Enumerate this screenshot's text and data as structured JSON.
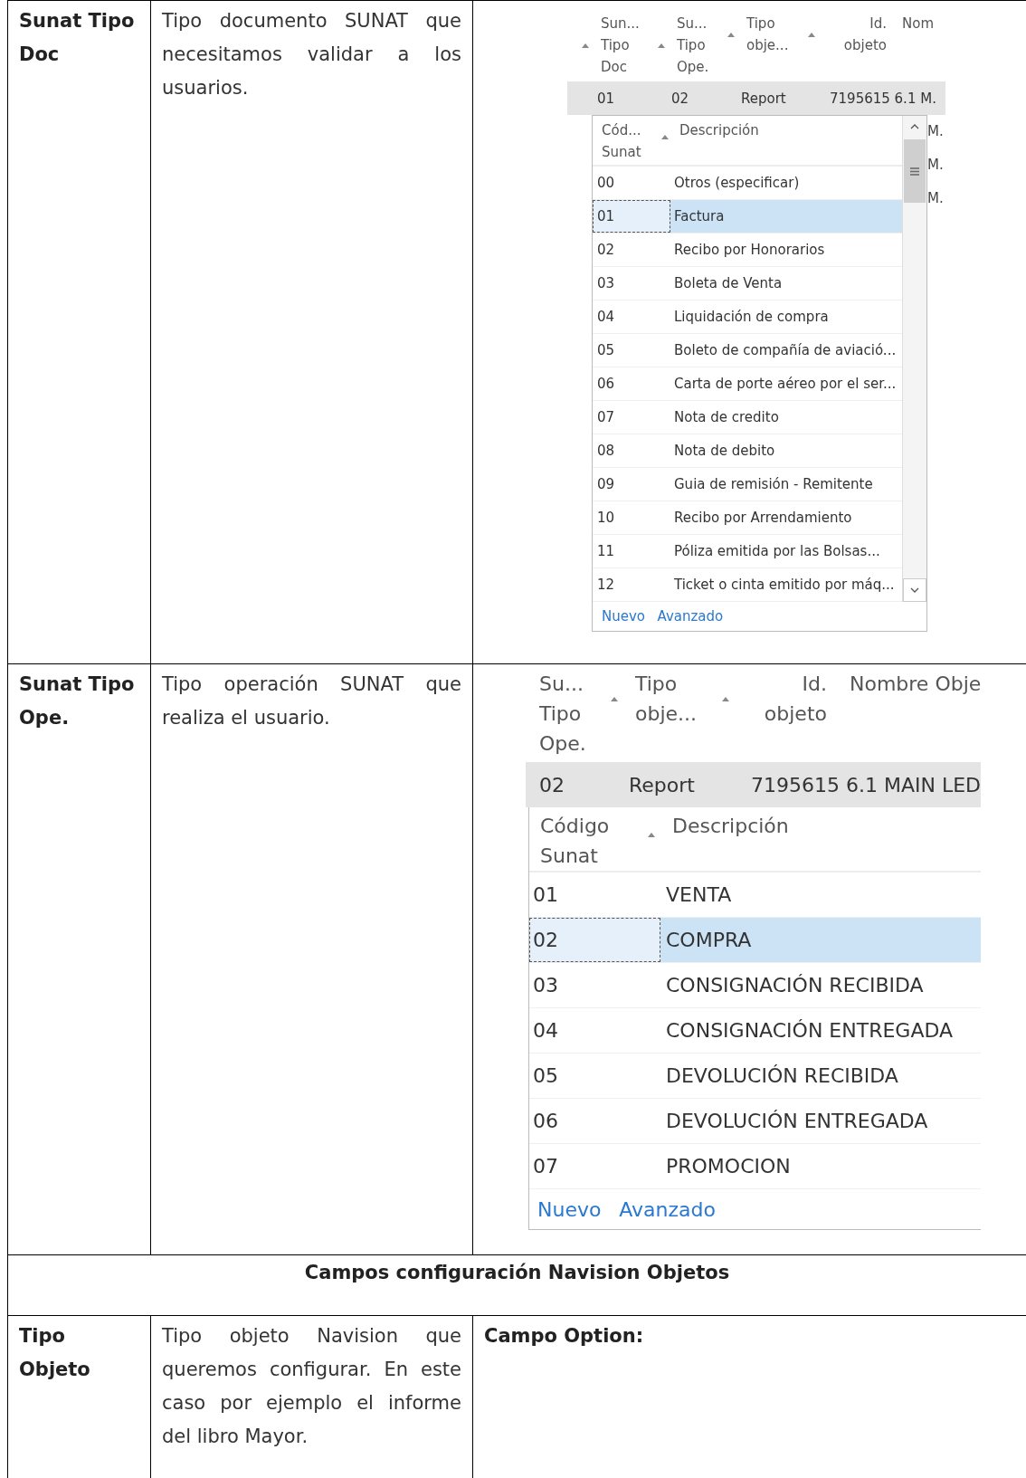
{
  "table": {
    "rows": [
      {
        "kind": "field",
        "label": "Sunat Tipo Doc",
        "description": "Tipo documento SUNAT que necesitamos validar a los usuarios.",
        "screenshot": {
          "grid_columns": [
            {
              "title": "Sun...\nTipo\nDoc",
              "sort_mark": true
            },
            {
              "title": "Su...\nTipo\nOpe.",
              "sort_mark": true
            },
            {
              "title": "Tipo\nobje...",
              "sort_mark": true
            },
            {
              "title": "Id.\nobjeto",
              "sort_mark": true
            },
            {
              "title": "Nom",
              "sort_mark": false
            }
          ],
          "grid_row": [
            "01",
            "02",
            "Report",
            "7195615 6.1 M."
          ],
          "side_values": [
            "M.",
            "M.",
            "M."
          ],
          "dropdown": {
            "columns": [
              {
                "title": "Cód...\nSunat",
                "sort_mark": false
              },
              {
                "title": "Descripción",
                "sort_mark": true
              }
            ],
            "rows": [
              {
                "code": "00",
                "description": "Otros (especificar)",
                "selected": false
              },
              {
                "code": "01",
                "description": "Factura",
                "selected": true
              },
              {
                "code": "02",
                "description": "Recibo por Honorarios",
                "selected": false
              },
              {
                "code": "03",
                "description": "Boleta de Venta",
                "selected": false
              },
              {
                "code": "04",
                "description": "Liquidación de compra",
                "selected": false
              },
              {
                "code": "05",
                "description": "Boleto de compañía de aviació...",
                "selected": false
              },
              {
                "code": "06",
                "description": "Carta de porte aéreo por el ser...",
                "selected": false
              },
              {
                "code": "07",
                "description": "Nota de credito",
                "selected": false
              },
              {
                "code": "08",
                "description": "Nota de debito",
                "selected": false
              },
              {
                "code": "09",
                "description": "Guia de remisión - Remitente",
                "selected": false
              },
              {
                "code": "10",
                "description": "Recibo por Arrendamiento",
                "selected": false
              },
              {
                "code": "11",
                "description": "Póliza emitida por las Bolsas...",
                "selected": false
              },
              {
                "code": "12",
                "description": "Ticket o cinta emitido por máq...",
                "selected": false
              }
            ],
            "links": [
              "Nuevo",
              "Avanzado"
            ]
          }
        }
      },
      {
        "kind": "field",
        "label": "Sunat Tipo Ope.",
        "description": "Tipo operación SUNAT que realiza el usuario.",
        "screenshot": {
          "grid_columns": [
            {
              "title": "Su...\nTipo\nOpe.",
              "sort_mark": false
            },
            {
              "title": "Tipo\nobje...",
              "sort_mark": true
            },
            {
              "title": "Id.\nobjeto",
              "sort_mark": true
            },
            {
              "title": "Nombre Obje",
              "sort_mark": false
            }
          ],
          "grid_row": [
            "02",
            "Report",
            "7195615 6.1 MAIN LED"
          ],
          "dropdown": {
            "columns": [
              {
                "title": "Código\nSunat",
                "sort_mark": false
              },
              {
                "title": "Descripción",
                "sort_mark": true
              }
            ],
            "rows": [
              {
                "code": "01",
                "description": "VENTA",
                "selected": false
              },
              {
                "code": "02",
                "description": "COMPRA",
                "selected": true
              },
              {
                "code": "03",
                "description": "CONSIGNACIÓN RECIBIDA",
                "selected": false
              },
              {
                "code": "04",
                "description": "CONSIGNACIÓN ENTREGADA",
                "selected": false
              },
              {
                "code": "05",
                "description": "DEVOLUCIÓN RECIBIDA",
                "selected": false
              },
              {
                "code": "06",
                "description": "DEVOLUCIÓN ENTREGADA",
                "selected": false
              },
              {
                "code": "07",
                "description": "PROMOCION",
                "selected": false
              }
            ],
            "links": [
              "Nuevo",
              "Avanzado"
            ]
          }
        }
      },
      {
        "kind": "section",
        "title": "Campos configuración Navision Objetos"
      },
      {
        "kind": "field",
        "label": "Tipo Objeto",
        "description": "Tipo objeto Navision que queremos configurar. En este caso por ejemplo el informe del libro Mayor.",
        "detail": "Campo Option:"
      }
    ]
  }
}
